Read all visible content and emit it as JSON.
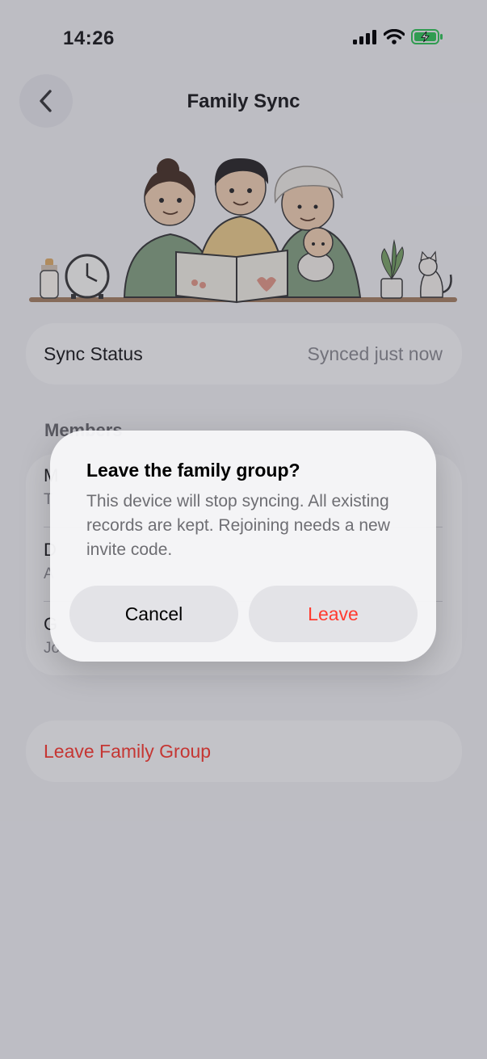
{
  "status_bar": {
    "time": "14:26"
  },
  "nav": {
    "title": "Family Sync",
    "back_icon": "chevron-left-icon"
  },
  "sync": {
    "label": "Sync Status",
    "value": "Synced just now"
  },
  "members": {
    "header": "Members",
    "rows": [
      {
        "name": "M",
        "sub": "T"
      },
      {
        "name": "D",
        "sub": "A"
      },
      {
        "name": "G",
        "sub": "Jo"
      }
    ]
  },
  "leave_group": {
    "label": "Leave Family Group"
  },
  "dialog": {
    "title": "Leave the family group?",
    "message": "This device will stop syncing. All existing records are kept. Rejoining needs a new invite code.",
    "cancel_label": "Cancel",
    "confirm_label": "Leave"
  },
  "colors": {
    "accent_red": "#ff3b30",
    "battery_green": "#34c759",
    "background": "#f4f4f6"
  }
}
